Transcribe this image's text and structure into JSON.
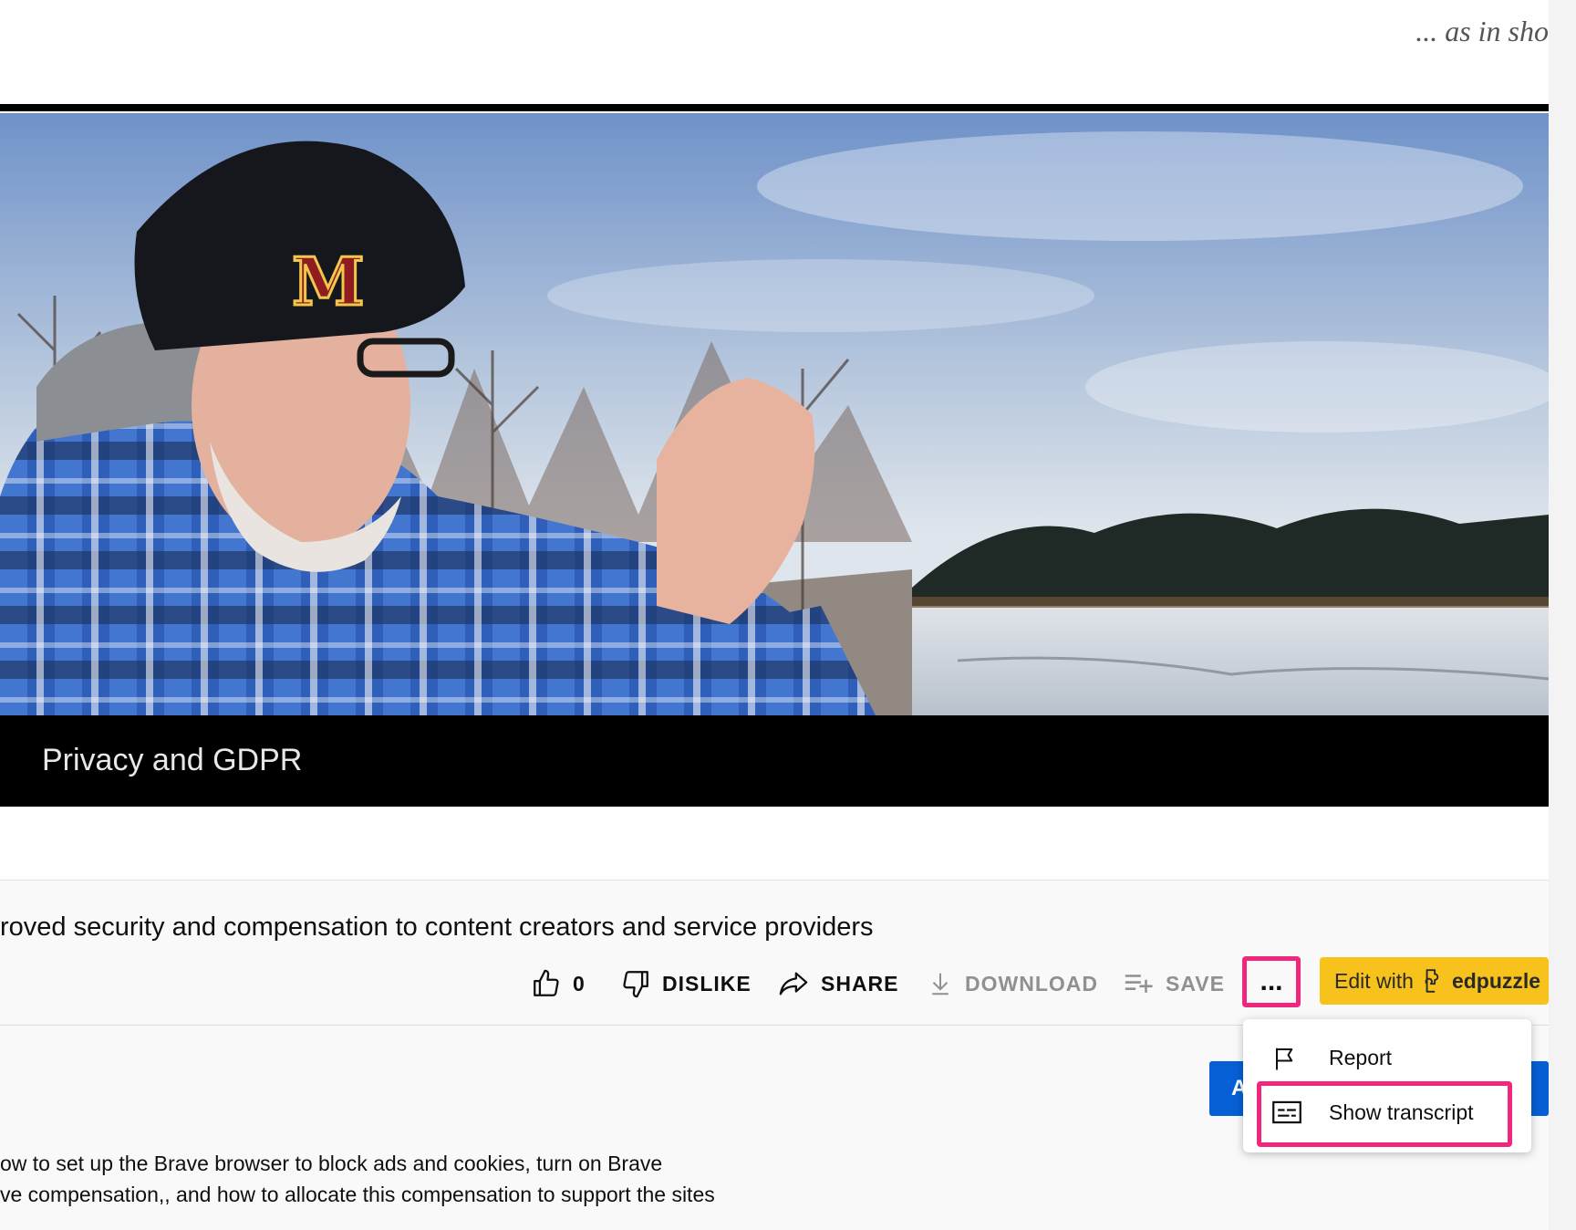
{
  "header": {
    "tagline": "... as in sho"
  },
  "video": {
    "caption": "Privacy and GDPR"
  },
  "video_info": {
    "title": "roved security and compensation to content creators and service providers",
    "like_count": "0",
    "dislike_label": "DISLIKE",
    "share_label": "SHARE",
    "download_label": "DOWNLOAD",
    "save_label": "SAVE",
    "more_label": "...",
    "edpuzzle_prefix": "Edit with",
    "edpuzzle_brand": "edpuzzle"
  },
  "menu": {
    "report_label": "Report",
    "transcript_label": "Show transcript"
  },
  "subscribe": {
    "label": "A"
  },
  "description": {
    "line1": "ow to set up the Brave browser to block ads and cookies, turn on Brave",
    "line2": "ve compensation,, and how to allocate this compensation to support the sites"
  },
  "colors": {
    "highlight": "#f0277d",
    "edpuzzle": "#f7c21b",
    "subscribe": "#065fd4"
  }
}
